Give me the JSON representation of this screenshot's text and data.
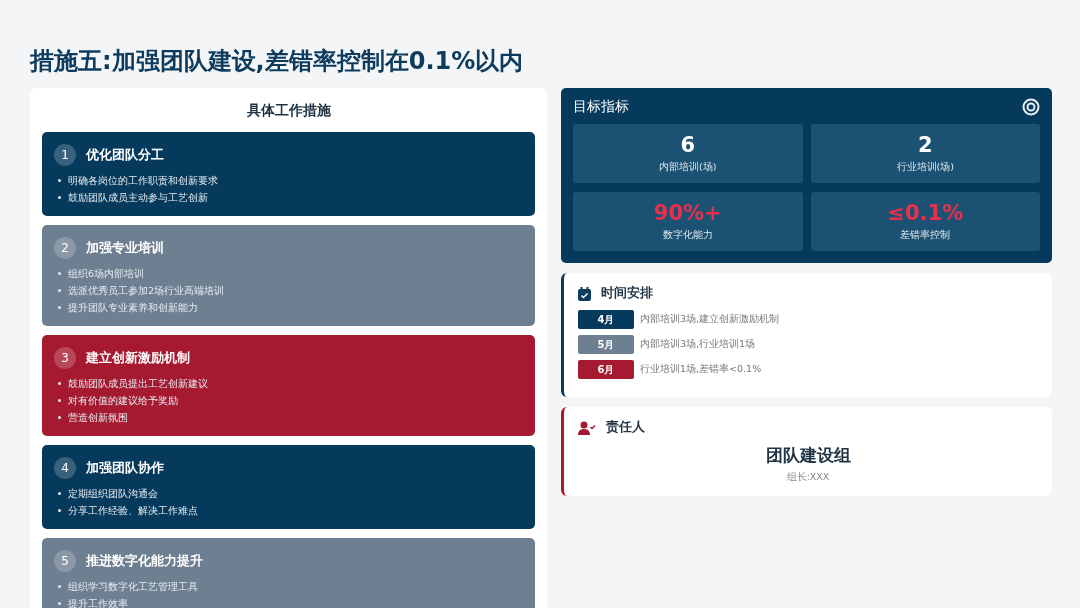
{
  "title": "措施五:加强团队建设,差错率控制在0.1%以内",
  "measures": {
    "heading": "具体工作措施",
    "cards": [
      {
        "number": "1",
        "title": "优化团队分工",
        "color": "#063a5c",
        "bullets": [
          "明确各岗位的工作职责和创新要求",
          "鼓励团队成员主动参与工艺创新"
        ]
      },
      {
        "number": "2",
        "title": "加强专业培训",
        "color": "#6e7f92",
        "bullets": [
          "组织6场内部培训",
          "选派优秀员工参加2场行业高端培训",
          "提升团队专业素养和创新能力"
        ]
      },
      {
        "number": "3",
        "title": "建立创新激励机制",
        "color": "#a51a30",
        "bullets": [
          "鼓励团队成员提出工艺创新建议",
          "对有价值的建议给予奖励",
          "营造创新氛围"
        ]
      },
      {
        "number": "4",
        "title": "加强团队协作",
        "color": "#063a5c",
        "bullets": [
          "定期组织团队沟通会",
          "分享工作经验、解决工作难点"
        ]
      },
      {
        "number": "5",
        "title": "推进数字化能力提升",
        "color": "#6e7f92",
        "bullets": [
          "组织学习数字化工艺管理工具",
          "提升工作效率"
        ]
      }
    ]
  },
  "targets": {
    "heading": "目标指标",
    "metrics": [
      {
        "value": "6",
        "label": "内部培训(场)",
        "color": "#ffffff"
      },
      {
        "value": "2",
        "label": "行业培训(场)",
        "color": "#ffffff"
      },
      {
        "value": "90%+",
        "label": "数字化能力",
        "color": "#e8304c"
      },
      {
        "value": "≤0.1%",
        "label": "差错率控制",
        "color": "#e8304c"
      }
    ]
  },
  "schedule": {
    "heading": "时间安排",
    "items": [
      {
        "month": "4月",
        "text": "内部培训3场,建立创新激励机制",
        "color": "#063a5c"
      },
      {
        "month": "5月",
        "text": "内部培训3场,行业培训1场",
        "color": "#6e7f92"
      },
      {
        "month": "6月",
        "text": "行业培训1场,差错率<0.1%",
        "color": "#a51a30"
      }
    ]
  },
  "owner": {
    "heading": "责任人",
    "name": "团队建设组",
    "leader": "组长:XXX"
  }
}
